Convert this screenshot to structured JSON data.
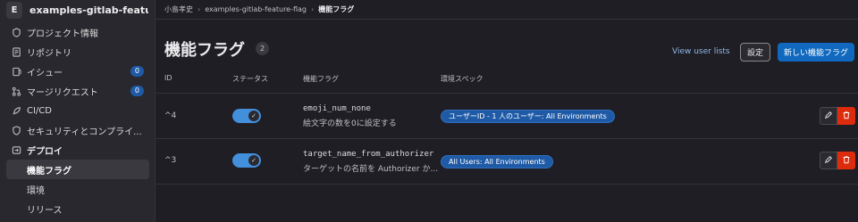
{
  "project": {
    "avatar_letter": "E",
    "name": "examples-gitlab-feature-fl..."
  },
  "sidebar": {
    "items": [
      {
        "label": "プロジェクト情報",
        "icon": "project-icon"
      },
      {
        "label": "リポジトリ",
        "icon": "repository-icon"
      },
      {
        "label": "イシュー",
        "icon": "issues-icon",
        "count": "0"
      },
      {
        "label": "マージリクエスト",
        "icon": "merge-request-icon",
        "count": "0"
      },
      {
        "label": "CI/CD",
        "icon": "rocket-icon"
      },
      {
        "label": "セキュリティとコンプライ...",
        "icon": "shield-icon"
      },
      {
        "label": "デプロイ",
        "icon": "deploy-icon"
      },
      {
        "label": "機能フラグ"
      },
      {
        "label": "環境"
      },
      {
        "label": "リリース"
      }
    ]
  },
  "breadcrumb": [
    "小島孝史",
    "examples-gitlab-feature-flag",
    "機能フラグ"
  ],
  "page": {
    "title": "機能フラグ",
    "count": "2",
    "view_user_lists": "View user lists",
    "settings_label": "設定",
    "new_flag_label": "新しい機能フラグ"
  },
  "table": {
    "headers": [
      "ID",
      "ステータス",
      "機能フラグ",
      "環境スペック"
    ],
    "rows": [
      {
        "id": "^4",
        "enabled": true,
        "name": "emoji_num_none",
        "description": "絵文字の数を0に設定する",
        "env": "ユーザーID - 1 人のユーザー: All Environments"
      },
      {
        "id": "^3",
        "enabled": true,
        "name": "target_name_from_authorizer",
        "description": "ターゲットの名前を Authorizer か...",
        "env": "All Users: All Environments"
      }
    ]
  },
  "colors": {
    "accent": "#1068bf",
    "danger": "#dd2b0e",
    "toggle_on": "#428fdc",
    "badge": "#1f5aa6",
    "link": "#8fb8ea"
  }
}
